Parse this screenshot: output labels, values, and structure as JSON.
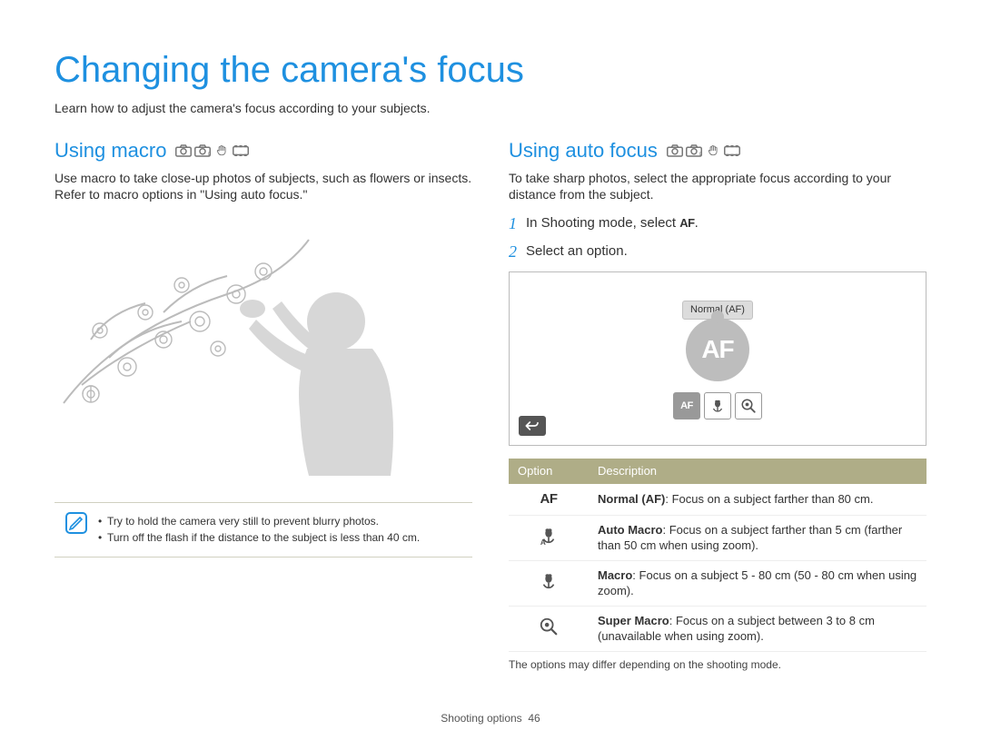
{
  "page": {
    "title": "Changing the camera's focus",
    "intro": "Learn how to adjust the camera's focus according to your subjects.",
    "footer_section": "Shooting options",
    "footer_pagenum": "46"
  },
  "left": {
    "heading": "Using macro",
    "body": "Use macro to take close-up photos of subjects, such as flowers or insects. Refer to macro options in \"Using auto focus.\"",
    "tips": [
      "Try to hold the camera very still to prevent blurry photos.",
      "Turn off the flash if the distance to the subject is less than 40 cm."
    ]
  },
  "right": {
    "heading": "Using auto focus",
    "body": "To take sharp photos, select the appropriate focus according to your distance from the subject.",
    "step1_pre": "In Shooting mode, select ",
    "step1_post": ".",
    "step_af_inline": "AF",
    "step2": "Select an option.",
    "preview_label": "Normal (AF)",
    "preview_af": "AF",
    "tile_af": "AF",
    "table": {
      "header_option": "Option",
      "header_desc": "Description",
      "rows": [
        {
          "icon": "af",
          "bold": "Normal (AF)",
          "text": ": Focus on a subject farther than 80 cm."
        },
        {
          "icon": "automacro",
          "bold": "Auto Macro",
          "text": ": Focus on a subject farther than 5 cm (farther than 50 cm when using zoom)."
        },
        {
          "icon": "macro",
          "bold": "Macro",
          "text": ": Focus on a subject 5 - 80 cm (50 - 80 cm when using zoom)."
        },
        {
          "icon": "supermacro",
          "bold": "Super Macro",
          "text": ": Focus on a subject between 3 to 8 cm (unavailable when using zoom)."
        }
      ]
    },
    "note": "The options may differ depending on the shooting mode."
  }
}
